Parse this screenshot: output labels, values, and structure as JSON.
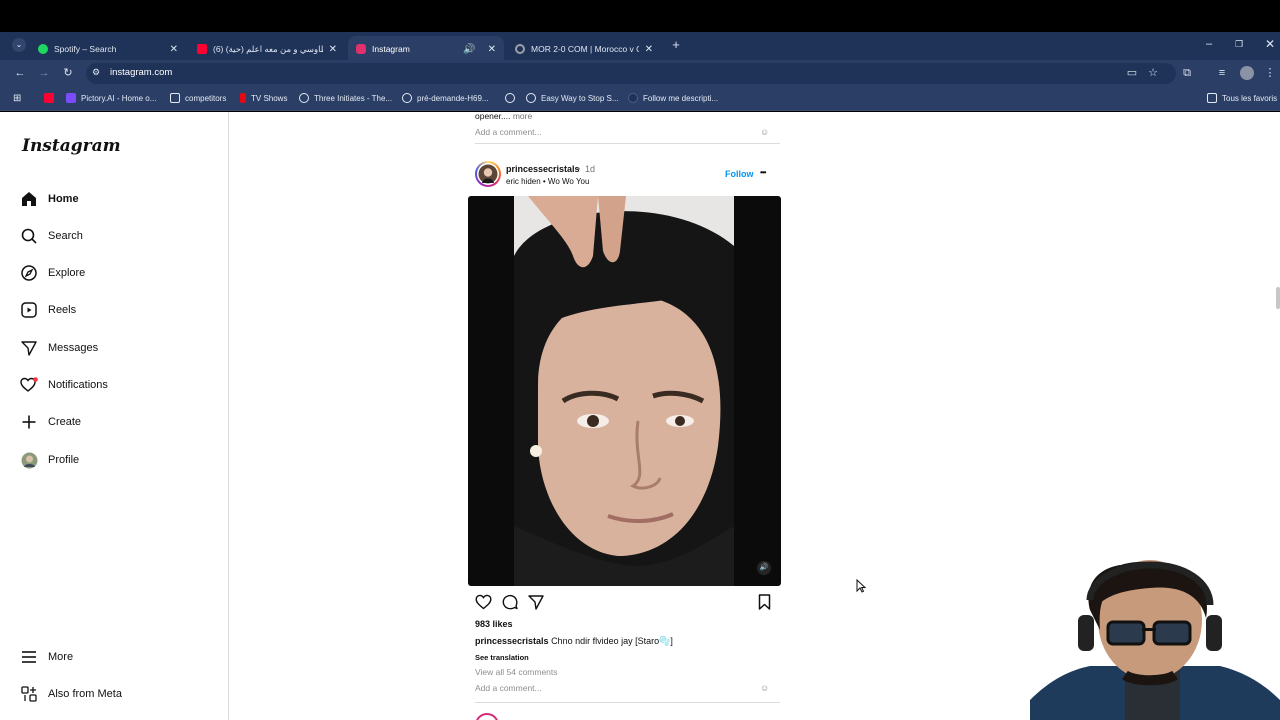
{
  "browser": {
    "tabs": [
      {
        "title": "Spotify – Search",
        "fav_color": "#1ed760",
        "active": false
      },
      {
        "title": "(6) الطاوسي و من معه اعلم (حية)",
        "fav_color": "#ff0033",
        "active": false
      },
      {
        "title": "Instagram",
        "fav_color": "#e1306c",
        "active": true
      },
      {
        "title": "MOR 2-0 COM | Morocco v Co",
        "fav_color": "#9aa0a6",
        "active": false
      }
    ],
    "url": "instagram.com",
    "bookmarks": [
      {
        "label": "",
        "color": "#ff0033"
      },
      {
        "label": "Pictory.AI - Home o...",
        "color": "#7b4dff"
      },
      {
        "label": "competitors",
        "color": "#e4eaf4"
      },
      {
        "label": "TV Shows",
        "color": "#e50914"
      },
      {
        "label": "Three Initiates - The...",
        "color": "#e4eaf4"
      },
      {
        "label": "pré-demande-H69...",
        "color": "#e4eaf4"
      },
      {
        "label": "",
        "color": "#e4eaf4"
      },
      {
        "label": "Easy Way to Stop S...",
        "color": "#e4eaf4"
      },
      {
        "label": "Follow me descripti...",
        "color": "#1f3358"
      },
      {
        "label": "Tous les favoris",
        "color": "#e4eaf4"
      }
    ]
  },
  "instagram": {
    "logo": "Instagram",
    "nav": [
      {
        "label": "Home",
        "icon": "home-icon"
      },
      {
        "label": "Search",
        "icon": "search-icon"
      },
      {
        "label": "Explore",
        "icon": "explore-icon"
      },
      {
        "label": "Reels",
        "icon": "reels-icon"
      },
      {
        "label": "Messages",
        "icon": "messages-icon"
      },
      {
        "label": "Notifications",
        "icon": "heart-icon"
      },
      {
        "label": "Create",
        "icon": "plus-icon"
      },
      {
        "label": "Profile",
        "icon": "avatar"
      }
    ],
    "more": "More",
    "also_from_meta": "Also from Meta"
  },
  "prev_post": {
    "caption_tail": "opener....",
    "more": "more",
    "add_comment": "Add a comment..."
  },
  "post": {
    "username": "princessecristals",
    "dot": "•",
    "time": "1d",
    "audio": "eric hiden • Wo Wo You",
    "follow": "Follow",
    "options": "•••",
    "likes": "983 likes",
    "caption_user": "princessecristals",
    "caption_text": "Chno ndir flvideo jay [Staro🫧]",
    "see_translation": "See translation",
    "view_comments": "View all 54 comments",
    "add_comment": "Add a comment..."
  },
  "colors": {
    "follow": "#0095f6",
    "chrome_dark": "#1f3358",
    "chrome": "#2b3f66"
  }
}
